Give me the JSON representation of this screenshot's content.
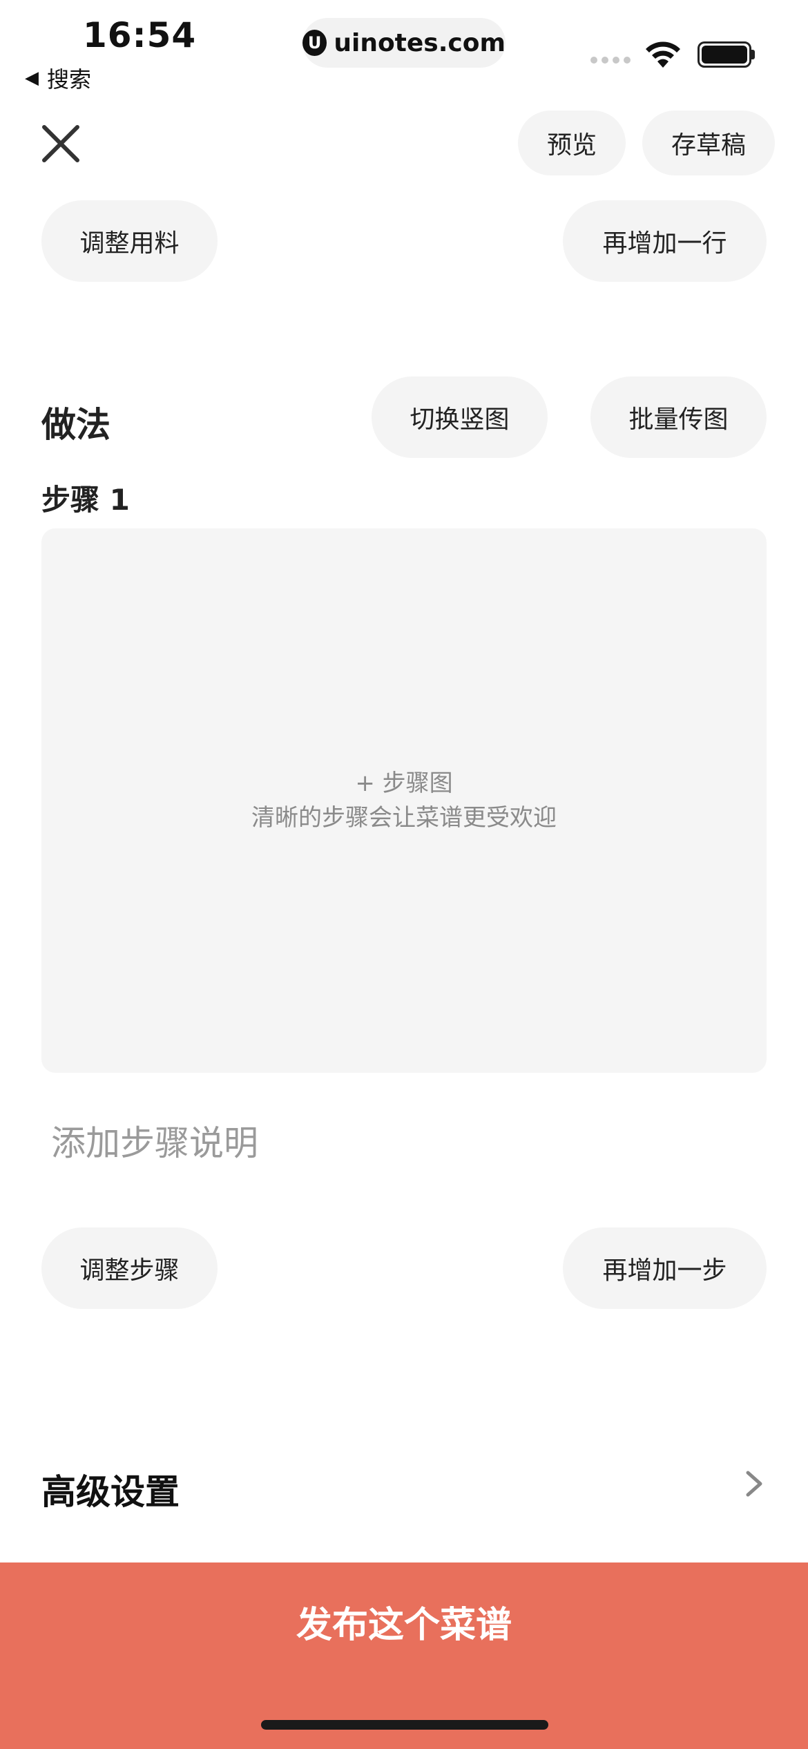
{
  "status_bar": {
    "time": "16:54",
    "back_label": "搜索",
    "url": "uinotes.com"
  },
  "top_bar": {
    "close_icon": "close-icon",
    "preview_label": "预览",
    "save_draft_label": "存草稿"
  },
  "ingredients": {
    "adjust_label": "调整用料",
    "add_row_label": "再增加一行"
  },
  "method": {
    "title": "做法",
    "toggle_vertical_label": "切换竖图",
    "batch_upload_label": "批量传图",
    "step_label": "步骤 1",
    "upload_title": "+ 步骤图",
    "upload_hint": "清晰的步骤会让菜谱更受欢迎",
    "desc_placeholder": "添加步骤说明",
    "adjust_steps_label": "调整步骤",
    "add_step_label": "再增加一步"
  },
  "advanced": {
    "title": "高级设置",
    "chevron_icon": "chevron-right-icon"
  },
  "publish": {
    "label": "发布这个菜谱",
    "color": "#e8705c"
  }
}
